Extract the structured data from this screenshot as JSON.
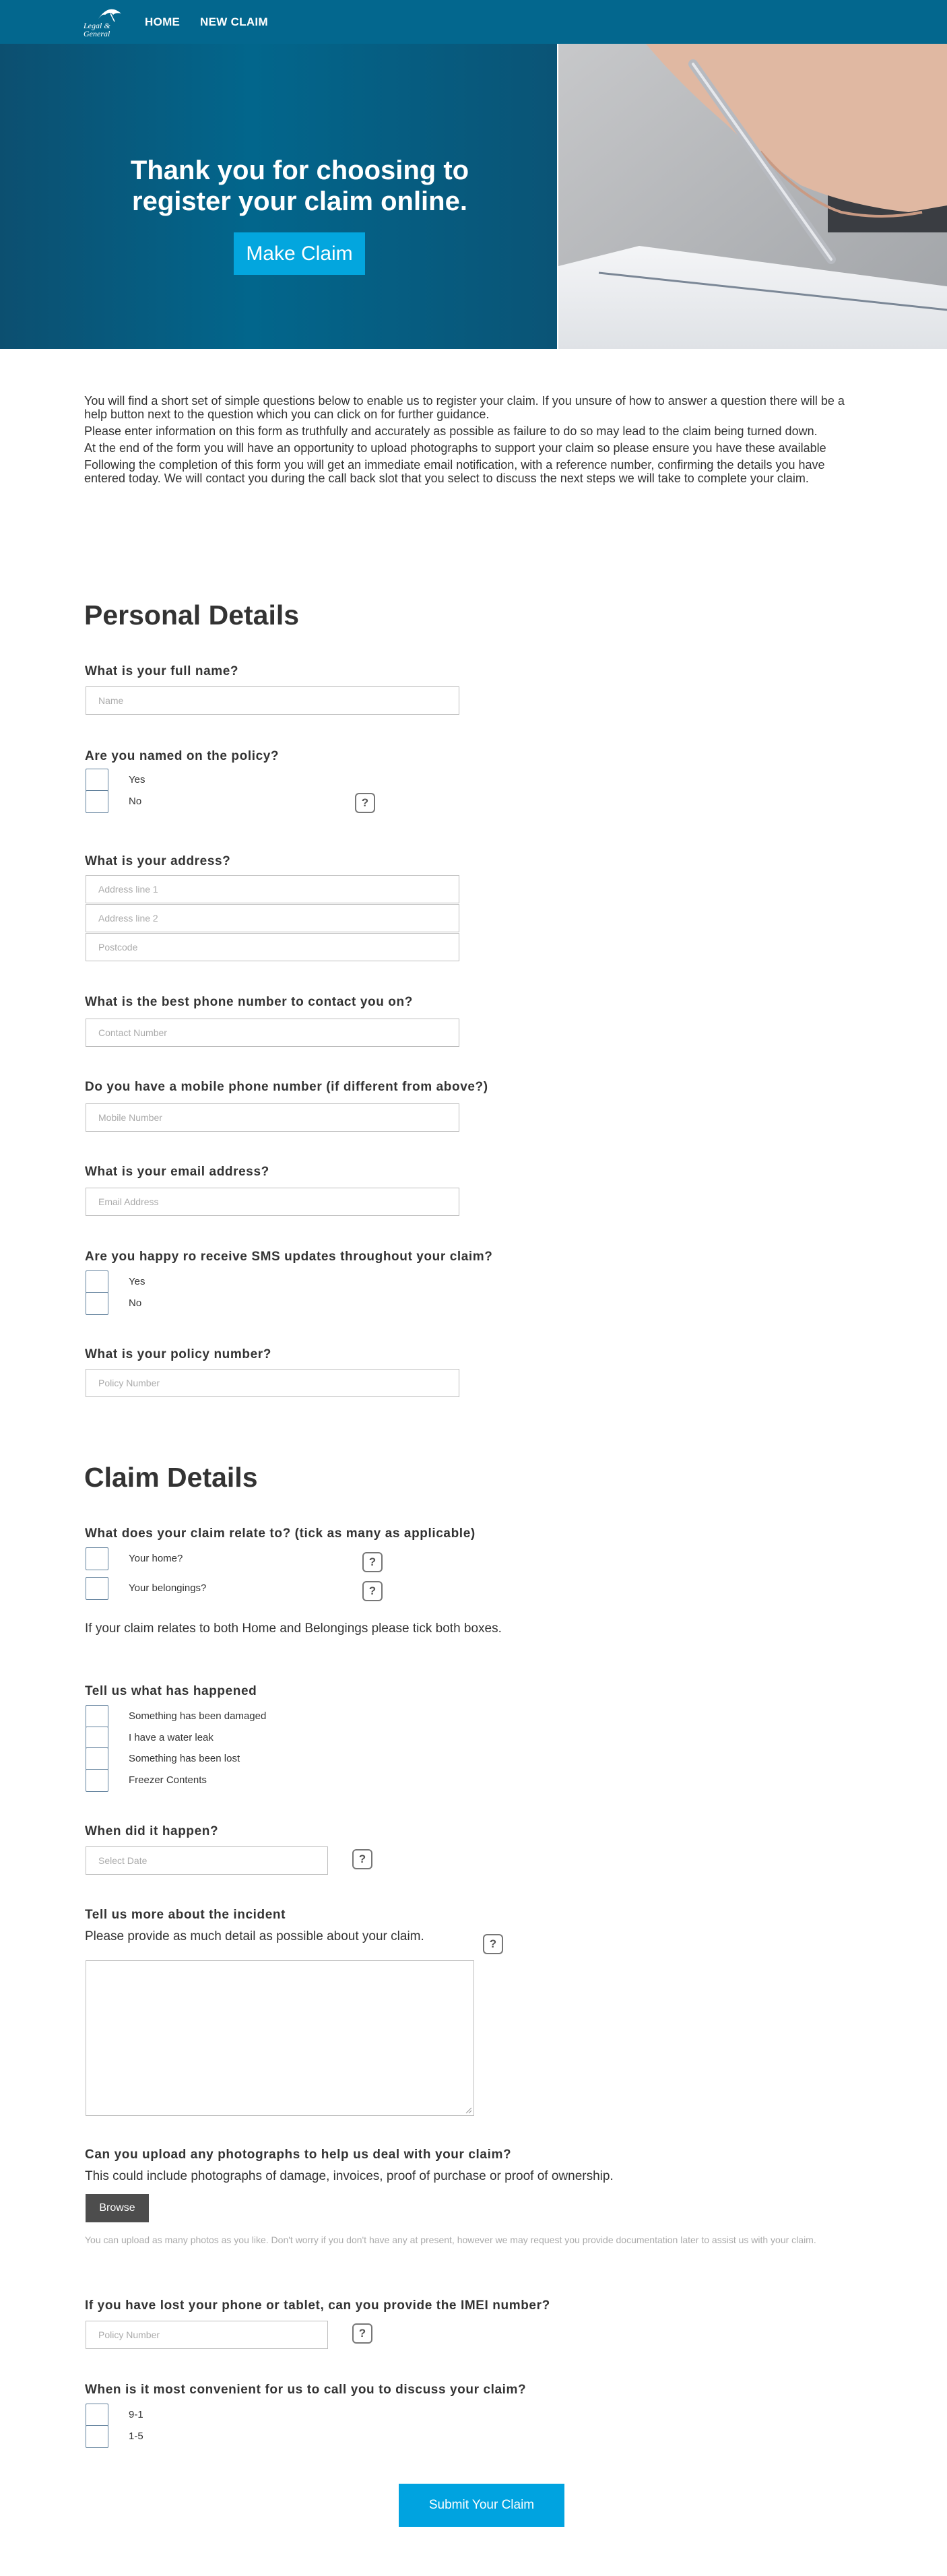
{
  "nav": {
    "logo_text_line1": "Legal &",
    "logo_text_line2": "General",
    "links": [
      "HOME",
      "NEW CLAIM"
    ]
  },
  "hero": {
    "title_line1": "Thank you for choosing to",
    "title_line2": "register your claim online.",
    "button": "Make Claim"
  },
  "intro": [
    "You will find a short set of simple questions below to enable us to register your claim. If you unsure of how to answer a question there will be a help button next to the question which you can click on for further guidance.",
    "Please enter information on this form as truthfully and accurately as possible as failure to do so may lead to the claim being turned down.",
    "At the end of the form you will have an opportunity to upload photographs to support your claim so please ensure you have these available",
    "Following the completion of this form you will get an immediate email notification, with a reference number, confirming the details you have entered today. We will contact you during the call back slot that you select to discuss the next steps we will take to complete your claim."
  ],
  "personal": {
    "heading": "Personal Details",
    "full_name": {
      "question": "What is your full name?",
      "placeholder": "Name"
    },
    "named": {
      "question": "Are you named on the policy?",
      "options": [
        "Yes",
        "No"
      ]
    },
    "address": {
      "question": "What is your address?",
      "placeholders": [
        "Address line 1",
        "Address line 2",
        "Postcode"
      ]
    },
    "phone": {
      "question": "What is the best phone number to contact you on?",
      "placeholder": "Contact Number"
    },
    "mobile": {
      "question": "Do you have a mobile phone number (if different from above?)",
      "placeholder": "Mobile Number"
    },
    "email": {
      "question": "What is your email address?",
      "placeholder": "Email Address"
    },
    "sms": {
      "question": "Are you happy ro receive SMS updates throughout your claim?",
      "options": [
        "Yes",
        "No"
      ]
    },
    "policy": {
      "question": "What is your policy number?",
      "placeholder": "Policy Number"
    }
  },
  "claim": {
    "heading": "Claim Details",
    "relates": {
      "question": "What does your claim relate to? (tick as many as applicable)",
      "options": [
        "Your home?",
        "Your belongings?"
      ],
      "note": "If your claim relates to both Home and Belongings please tick both boxes."
    },
    "happened": {
      "question": "Tell us what has happened",
      "options": [
        "Something has been damaged",
        "I have a water leak",
        "Something has been lost",
        "Freezer Contents"
      ]
    },
    "when": {
      "question": "When did it happen?",
      "placeholder": "Select Date"
    },
    "incident": {
      "question": "Tell us more about the incident",
      "hint": "Please provide as much detail as possible about your claim."
    },
    "photos": {
      "question": "Can you upload any photographs to help us deal with your claim?",
      "hint": "This could include photographs of damage, invoices, proof of purchase or proof of ownership.",
      "button": "Browse",
      "note": "You can upload as many photos as you like. Don't worry if you don't have any at present, however we may request you provide documentation later to assist us with your claim."
    },
    "imei": {
      "question": "If you have lost your phone or tablet, can you provide the IMEI number?",
      "placeholder": "Policy Number"
    },
    "call": {
      "question": "When is it most convenient for us to call you to discuss your claim?",
      "options": [
        "9-1",
        "1-5"
      ]
    },
    "submit": "Submit Your Claim"
  },
  "help_glyph": "?",
  "colors": {
    "nav": "#03678e",
    "accent": "#03a6de",
    "browse": "#4d4d4d"
  }
}
